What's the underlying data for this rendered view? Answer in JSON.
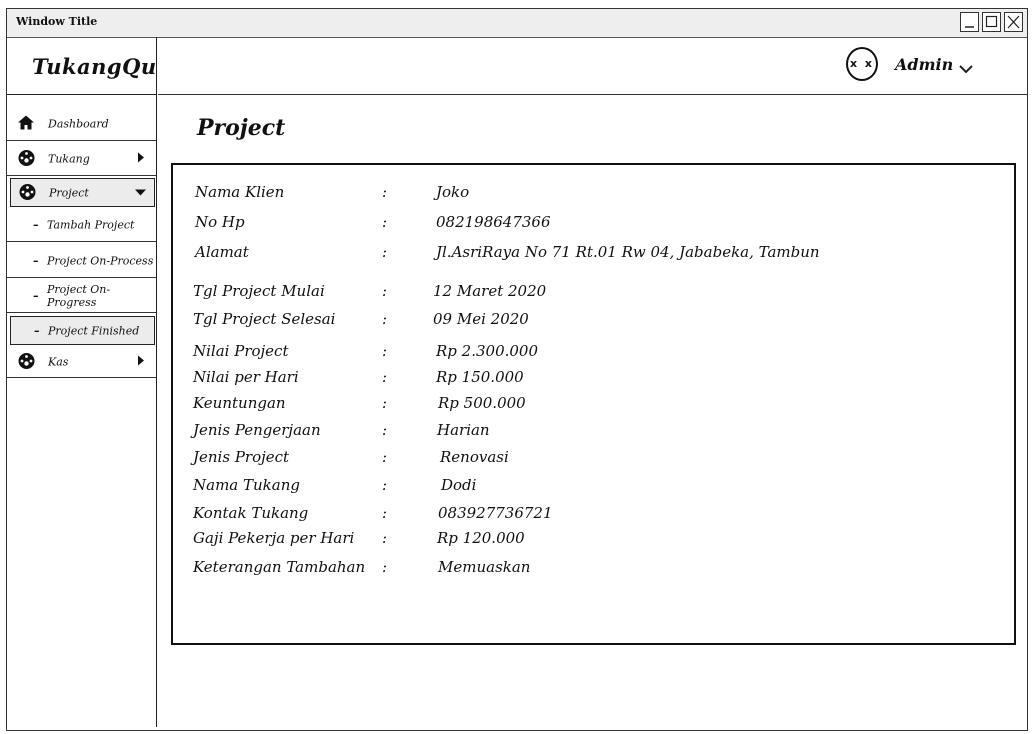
{
  "window": {
    "title": "Window Title"
  },
  "sidebar": {
    "brand": "TukangQu",
    "items": [
      {
        "label": "Dashboard",
        "icon": "home-icon"
      },
      {
        "label": "Tukang",
        "icon": "gauge-icon"
      },
      {
        "label": "Project",
        "icon": "gauge-icon"
      },
      {
        "label": "Tambah Project"
      },
      {
        "label": "Project On-Process"
      },
      {
        "label": "Project On-Progress"
      },
      {
        "label": "Project Finished"
      },
      {
        "label": "Kas",
        "icon": "gauge-icon"
      }
    ],
    "submenu_marker": "–"
  },
  "header": {
    "avatar_text": "x x",
    "user": "Admin"
  },
  "main": {
    "title": "Project",
    "separator": ":",
    "fields": [
      {
        "label": "Nama Klien",
        "value": "Joko"
      },
      {
        "label": "No Hp",
        "value": "082198647366"
      },
      {
        "label": "Alamat",
        "value": "Jl.AsriRaya No 71 Rt.01 Rw 04, Jababeka, Tambun"
      },
      {
        "label": "Tgl Project Mulai",
        "value": "12 Maret 2020"
      },
      {
        "label": "Tgl Project Selesai",
        "value": "09 Mei 2020"
      },
      {
        "label": "Nilai Project",
        "value": "Rp 2.300.000"
      },
      {
        "label": "Nilai per Hari",
        "value": "Rp 150.000"
      },
      {
        "label": "Keuntungan",
        "value": "Rp 500.000"
      },
      {
        "label": "Jenis Pengerjaan",
        "value": "Harian"
      },
      {
        "label": "Jenis Project",
        "value": "Renovasi"
      },
      {
        "label": "Nama Tukang",
        "value": "Dodi"
      },
      {
        "label": "Kontak Tukang",
        "value": "083927736721"
      },
      {
        "label": "Gaji Pekerja per Hari",
        "value": "Rp 120.000"
      },
      {
        "label": "Keterangan Tambahan",
        "value": "Memuaskan"
      }
    ]
  }
}
